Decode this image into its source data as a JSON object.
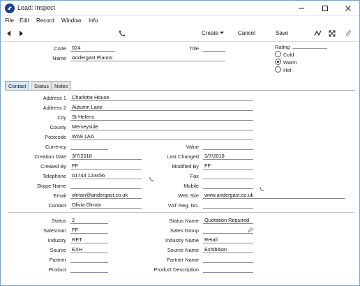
{
  "window": {
    "title": "Lead: Inspect",
    "minimize_label": "Minimize",
    "maximize_label": "Maximize",
    "close_label": "Close"
  },
  "menu": {
    "items": [
      "File",
      "Edit",
      "Record",
      "Window",
      "Info"
    ]
  },
  "toolbar": {
    "create_label": "Create",
    "cancel_label": "Cancel",
    "save_label": "Save"
  },
  "header": {
    "code_label": "Code",
    "code_value": "024",
    "name_label": "Name",
    "name_value": "Andergast Pianos",
    "title_label": "Title",
    "title_value": "",
    "rating_label": "Rating",
    "rating_options": [
      "Cold",
      "Warm",
      "Hot"
    ],
    "rating_selected": "Warm"
  },
  "tabs": [
    "Contact",
    "Status",
    "Notes"
  ],
  "contact": {
    "address1_label": "Address 1",
    "address1_value": "Charlotte House",
    "address2_label": "Address 2",
    "address2_value": "Autumn Lane",
    "city_label": "City",
    "city_value": "St Helens",
    "county_label": "County",
    "county_value": "Merseyside",
    "postcode_label": "Postcode",
    "postcode_value": "WA9 1AA",
    "currency_label": "Currency",
    "currency_value": "",
    "value_label": "Value",
    "value_value": "",
    "creation_date_label": "Creation Date",
    "creation_date_value": "3/7/2018",
    "last_changed_label": "Last Changed",
    "last_changed_value": "3/7/2018",
    "created_by_label": "Created By",
    "created_by_value": "FF",
    "modified_by_label": "Modified By",
    "modified_by_value": "FF",
    "telephone_label": "Telephone",
    "telephone_value": "01744 123456",
    "fax_label": "Fax",
    "fax_value": "",
    "skype_label": "Skype Name",
    "skype_value": "",
    "mobile_label": "Mobile",
    "mobile_value": "",
    "email_label": "Email",
    "email_value": "olman@andergast.co.uk",
    "website_label": "Web Site",
    "website_value": "www.andergast.co.uk",
    "contact_label": "Contact",
    "contact_value": "Olivia Olman",
    "vat_label": "VAT Reg. No.",
    "vat_value": ""
  },
  "status_section": {
    "status_label": "Status",
    "status_value": "2",
    "status_name_label": "Status Name",
    "status_name_value": "Quotation Required",
    "salesman_label": "Salesman",
    "salesman_value": "FF",
    "sales_group_label": "Sales Group",
    "sales_group_value": "",
    "industry_label": "Industry",
    "industry_value": "RET",
    "industry_name_label": "Industry Name",
    "industry_name_value": "Retail",
    "source_label": "Source",
    "source_value": "EXH",
    "source_name_label": "Source Name",
    "source_name_value": "Exhibition",
    "partner_label": "Partner",
    "partner_value": "",
    "partner_name_label": "Partner Name",
    "partner_name_value": "",
    "product_label": "Product",
    "product_value": "",
    "product_desc_label": "Product Description",
    "product_desc_value": ""
  },
  "colors": {
    "accent": "#1d3f8e",
    "tab_active": "#d6e8f7",
    "window_border": "#7aa0c8"
  }
}
